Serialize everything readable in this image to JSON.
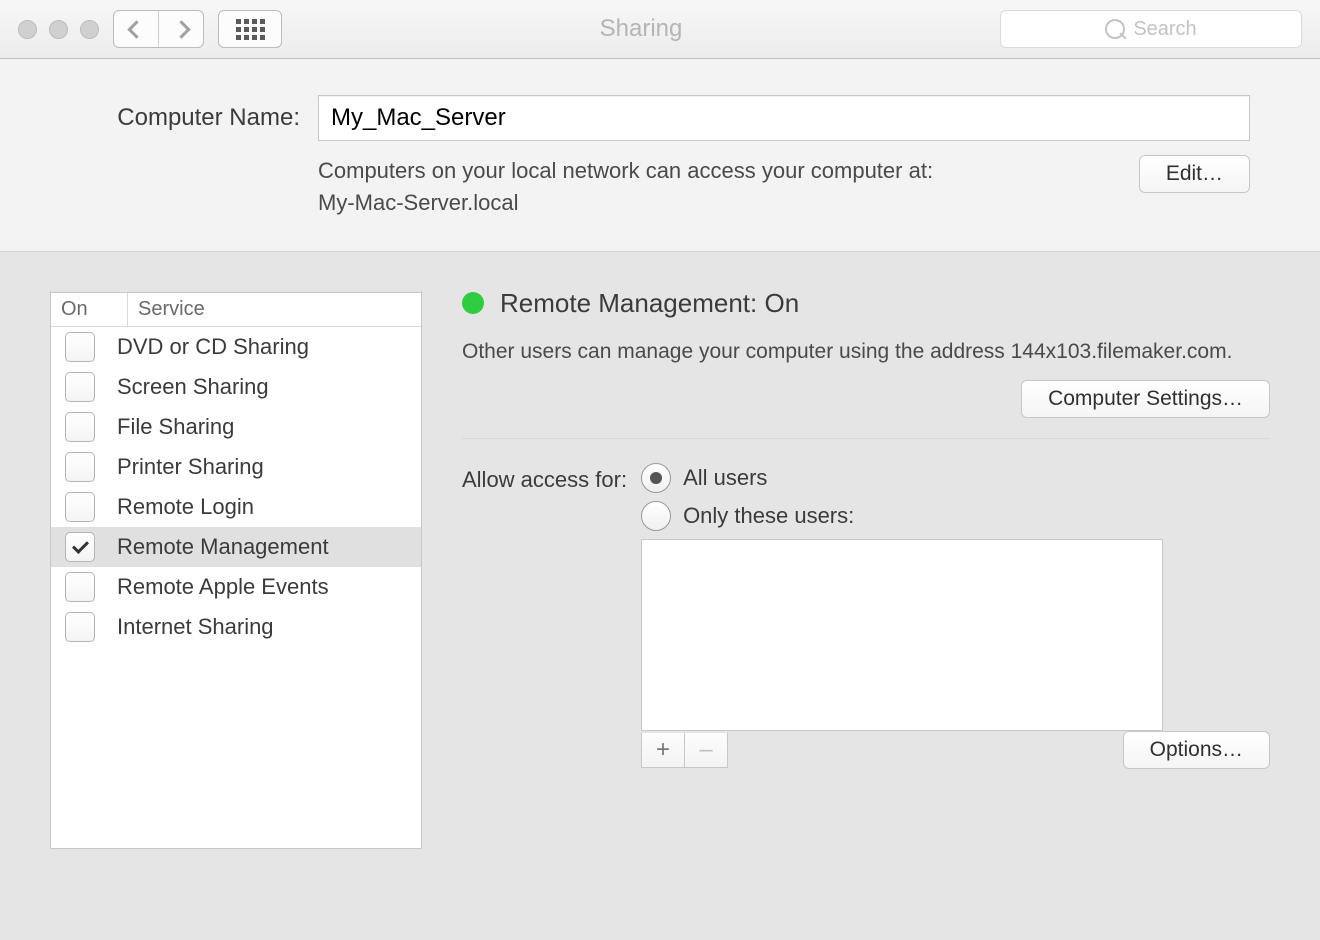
{
  "window_title": "Sharing",
  "search_placeholder": "Search",
  "computer_name": {
    "label": "Computer Name:",
    "value": "My_Mac_Server",
    "hint_line1": "Computers on your local network can access your computer at:",
    "hint_line2": "My-Mac-Server.local",
    "edit_button": "Edit…"
  },
  "services": {
    "col_on": "On",
    "col_service": "Service",
    "items": [
      {
        "checked": false,
        "name": "DVD or CD Sharing",
        "selected": false
      },
      {
        "checked": false,
        "name": "Screen Sharing",
        "selected": false
      },
      {
        "checked": false,
        "name": "File Sharing",
        "selected": false
      },
      {
        "checked": false,
        "name": "Printer Sharing",
        "selected": false
      },
      {
        "checked": false,
        "name": "Remote Login",
        "selected": false
      },
      {
        "checked": true,
        "name": "Remote Management",
        "selected": true
      },
      {
        "checked": false,
        "name": "Remote Apple Events",
        "selected": false
      },
      {
        "checked": false,
        "name": "Internet Sharing",
        "selected": false
      }
    ]
  },
  "detail": {
    "status_title": "Remote Management: On",
    "status_desc": "Other users can manage your computer using the address 144x103.filemaker.com.",
    "computer_settings_button": "Computer Settings…",
    "access_label": "Allow access for:",
    "radio_all": "All users",
    "radio_only": "Only these users:",
    "selected_radio": "all",
    "options_button": "Options…",
    "plus": "+",
    "minus": "–"
  }
}
